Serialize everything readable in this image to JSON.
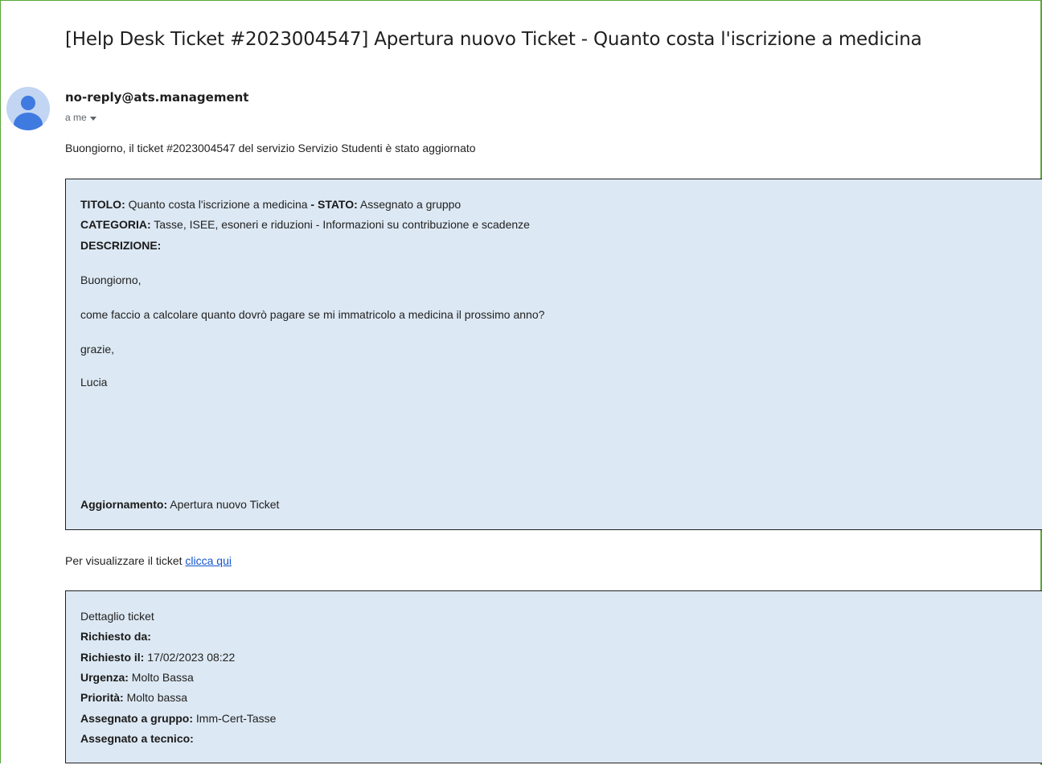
{
  "email": {
    "subject": "[Help Desk Ticket #2023004547] Apertura nuovo Ticket - Quanto costa l'iscrizione a medicina",
    "sender": "no-reply@ats.management",
    "to_label": "a me",
    "intro": "Buongiorno, il ticket #2023004547 del servizio Servizio Studenti è stato aggiornato",
    "colors": {
      "frame": "#5aa63a",
      "box_background": "#dce8f3",
      "link": "#1155cc",
      "avatar_bg": "#c2d5f2",
      "avatar_fg": "#3f7ae0"
    }
  },
  "ticket": {
    "titolo_label": "TITOLO:",
    "titolo_value": "Quanto costa l'iscrizione a medicina",
    "separator": "-",
    "stato_label": "STATO:",
    "stato_value": "Assegnato a gruppo",
    "categoria_label": "CATEGORIA:",
    "categoria_value": "Tasse, ISEE, esoneri e riduzioni - Informazioni su contribuzione e scadenze",
    "descrizione_label": "DESCRIZIONE:",
    "body_lines": [
      "Buongiorno,",
      "come faccio a calcolare quanto dovrò pagare se mi immatricolo a medicina il prossimo anno?",
      "grazie,",
      "Lucia"
    ],
    "aggiornamento_label": "Aggiornamento:",
    "aggiornamento_value": "Apertura nuovo Ticket"
  },
  "link_line": {
    "text": "Per visualizzare il ticket",
    "link_text": "clicca qui"
  },
  "details": {
    "heading": "Dettaglio ticket",
    "richiesto_da_label": "Richiesto da:",
    "richiesto_il_label": "Richiesto il:",
    "richiesto_il_value": "17/02/2023 08:22",
    "urgenza_label": "Urgenza:",
    "urgenza_value": "Molto Bassa",
    "priorita_label": "Priorità:",
    "priorita_value": "Molto bassa",
    "gruppo_label": "Assegnato a gruppo:",
    "gruppo_value": "Imm-Cert-Tasse",
    "tecnico_label": "Assegnato a tecnico:"
  }
}
